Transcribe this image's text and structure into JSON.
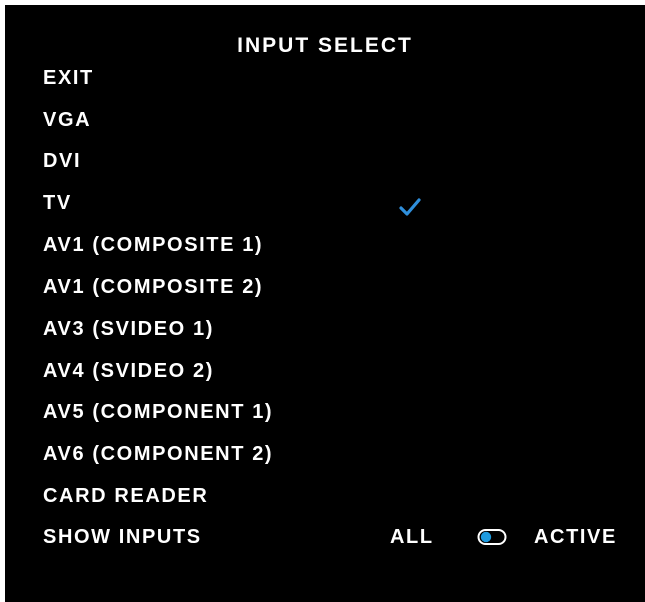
{
  "menu": {
    "title": "INPUT SELECT",
    "items": [
      {
        "label": "EXIT"
      },
      {
        "label": "VGA"
      },
      {
        "label": "DVI"
      },
      {
        "label": "TV"
      },
      {
        "label": "AV1 (COMPOSITE 1)"
      },
      {
        "label": "AV1 (COMPOSITE 2)"
      },
      {
        "label": "AV3 (SVIDEO 1)"
      },
      {
        "label": "AV4 (SVIDEO 2)"
      },
      {
        "label": "AV5 (COMPONENT 1)"
      },
      {
        "label": "AV6 (COMPONENT 2)"
      },
      {
        "label": "CARD READER"
      }
    ],
    "selected_item": "TV",
    "check_icon": "checkmark-icon",
    "check_color": "#2f8fdc"
  },
  "show_inputs": {
    "label": "SHOW INPUTS",
    "option_all": "ALL",
    "option_active": "ACTIVE",
    "selected": "ALL",
    "toggle_icon": "toggle-icon",
    "toggle_color": "#1e9be0"
  },
  "colors": {
    "background": "#000000",
    "text": "#ffffff"
  }
}
